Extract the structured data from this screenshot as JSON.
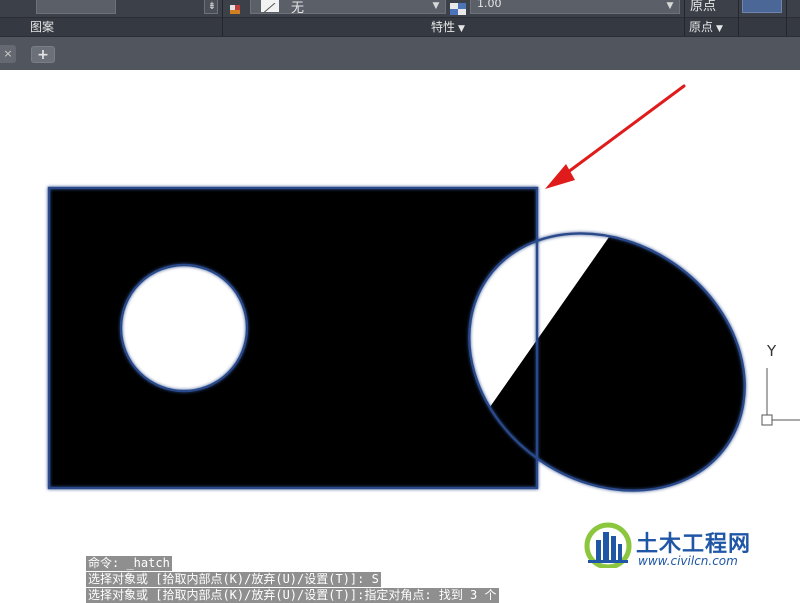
{
  "ribbon": {
    "hatch_type_value": "无",
    "transparency_value": "1.00",
    "origin_button_label": "原点",
    "panels": {
      "pattern": "图案",
      "properties": "特性",
      "origin": "原点"
    },
    "panel_dropdown_glyph": "▼"
  },
  "tabs": {
    "close_glyph": "×",
    "add_glyph": "+"
  },
  "canvas": {
    "ucs_y_label": "Y",
    "hatch_fill_color": "#000000",
    "boundary_color": "#2a4a8a",
    "arrow_color": "#e01b1b"
  },
  "command_history": [
    "命令: _hatch",
    "选择对象或 [拾取内部点(K)/放弃(U)/设置(T)]: S",
    "选择对象或 [拾取内部点(K)/放弃(U)/设置(T)]:指定对角点: 找到 3 个"
  ],
  "watermark": {
    "title": "土木工程网",
    "url": "www.civilcn.com"
  }
}
